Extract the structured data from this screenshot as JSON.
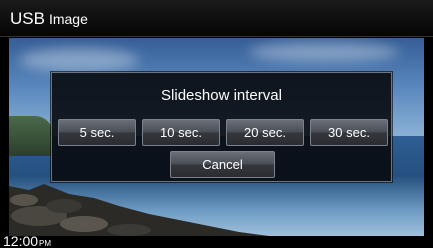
{
  "header": {
    "title_main": "USB",
    "title_sub": "Image"
  },
  "dialog": {
    "title": "Slideshow interval",
    "options": [
      "5 sec.",
      "10 sec.",
      "20 sec.",
      "30 sec."
    ],
    "cancel_label": "Cancel"
  },
  "status": {
    "time": "12:00",
    "ampm": "PM"
  },
  "colors": {
    "title_bar": "#0b0b0b",
    "dialog_bg": "#080a0e",
    "button": "#4a4e56",
    "text": "#ffffff"
  }
}
